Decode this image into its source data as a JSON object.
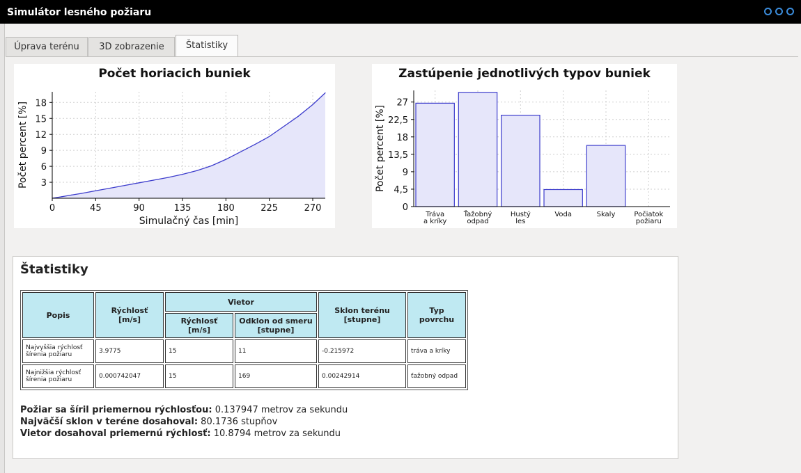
{
  "window": {
    "title": "Simulátor lesného požiaru"
  },
  "tabs": [
    {
      "label": "Úprava terénu"
    },
    {
      "label": "3D zobrazenie"
    },
    {
      "label": "Štatistiky"
    }
  ],
  "charts": {
    "line_title": "Počet horiacich buniek",
    "bar_title": "Zastúpenie jednotlivých typov buniek"
  },
  "chart_data": [
    {
      "type": "area",
      "title": "Počet horiacich buniek",
      "xlabel": "Simulačný čas [min]",
      "ylabel": "Počet percent [%]",
      "xlim": [
        0,
        283
      ],
      "ylim": [
        0,
        20
      ],
      "xticks": [
        "0",
        "45",
        "90",
        "135",
        "180",
        "225",
        "270"
      ],
      "yticks": [
        "3",
        "6",
        "9",
        "12",
        "15",
        "18"
      ],
      "x": [
        0,
        10,
        20,
        30,
        45,
        60,
        75,
        90,
        105,
        120,
        135,
        150,
        165,
        180,
        195,
        210,
        225,
        240,
        255,
        270,
        283
      ],
      "y": [
        0,
        0.3,
        0.6,
        0.9,
        1.4,
        1.9,
        2.4,
        2.9,
        3.4,
        3.9,
        4.5,
        5.2,
        6.1,
        7.3,
        8.7,
        10.1,
        11.6,
        13.5,
        15.4,
        17.6,
        19.8
      ],
      "color": "#3c3ccc",
      "grid": true
    },
    {
      "type": "bar",
      "title": "Zastúpenie jednotlivých typov buniek",
      "xlabel": "",
      "ylabel": "Počet percent [%]",
      "ylim": [
        0,
        30
      ],
      "yticks": [
        "0",
        "4,5",
        "9",
        "13,5",
        "18",
        "22,5",
        "27"
      ],
      "categories": [
        [
          "Tráva",
          "a kríky"
        ],
        [
          "Ťažobný",
          "odpad"
        ],
        [
          "Hustý",
          "les"
        ],
        [
          "Voda"
        ],
        [
          "Skaly"
        ],
        [
          "Počiatok",
          "požiaru"
        ]
      ],
      "values": [
        26.7,
        29.5,
        23.6,
        4.4,
        15.8,
        0
      ],
      "color": "#3c3ccc",
      "grid": true
    }
  ],
  "stats": {
    "heading": "Štatistiky",
    "headers": {
      "popis": "Popis",
      "rychlost": "Rýchlosť [m/s]",
      "vietor": "Vietor",
      "vietor_rychlost": "Rýchlosť [m/s]",
      "odklon": "Odklon od smeru [stupne]",
      "sklon": "Sklon terénu [stupne]",
      "povrch": "Typ povrchu"
    },
    "rows": [
      {
        "popis": "Najvyššia rýchlosť šírenia požiaru",
        "rychlost": "3.9775",
        "vietor_rychlost": "15",
        "odklon": "11",
        "sklon": "-0.215972",
        "povrch": "tráva a kríky"
      },
      {
        "popis": "Najnižšia rýchlosť šírenia požiaru",
        "rychlost": "0.000742047",
        "vietor_rychlost": "15",
        "odklon": "169",
        "sklon": "0.00242914",
        "povrch": "ťažobný odpad"
      }
    ],
    "summary": [
      {
        "label": "Požiar sa šíril priemernou rýchlosťou:",
        "value": "0.137947 metrov za sekundu"
      },
      {
        "label": "Najväčší sklon v teréne dosahoval:",
        "value": "80.1736 stupňov"
      },
      {
        "label": "Vietor dosahoval priemernú rýchlosť:",
        "value": "10.8794 metrov za sekundu"
      }
    ]
  }
}
